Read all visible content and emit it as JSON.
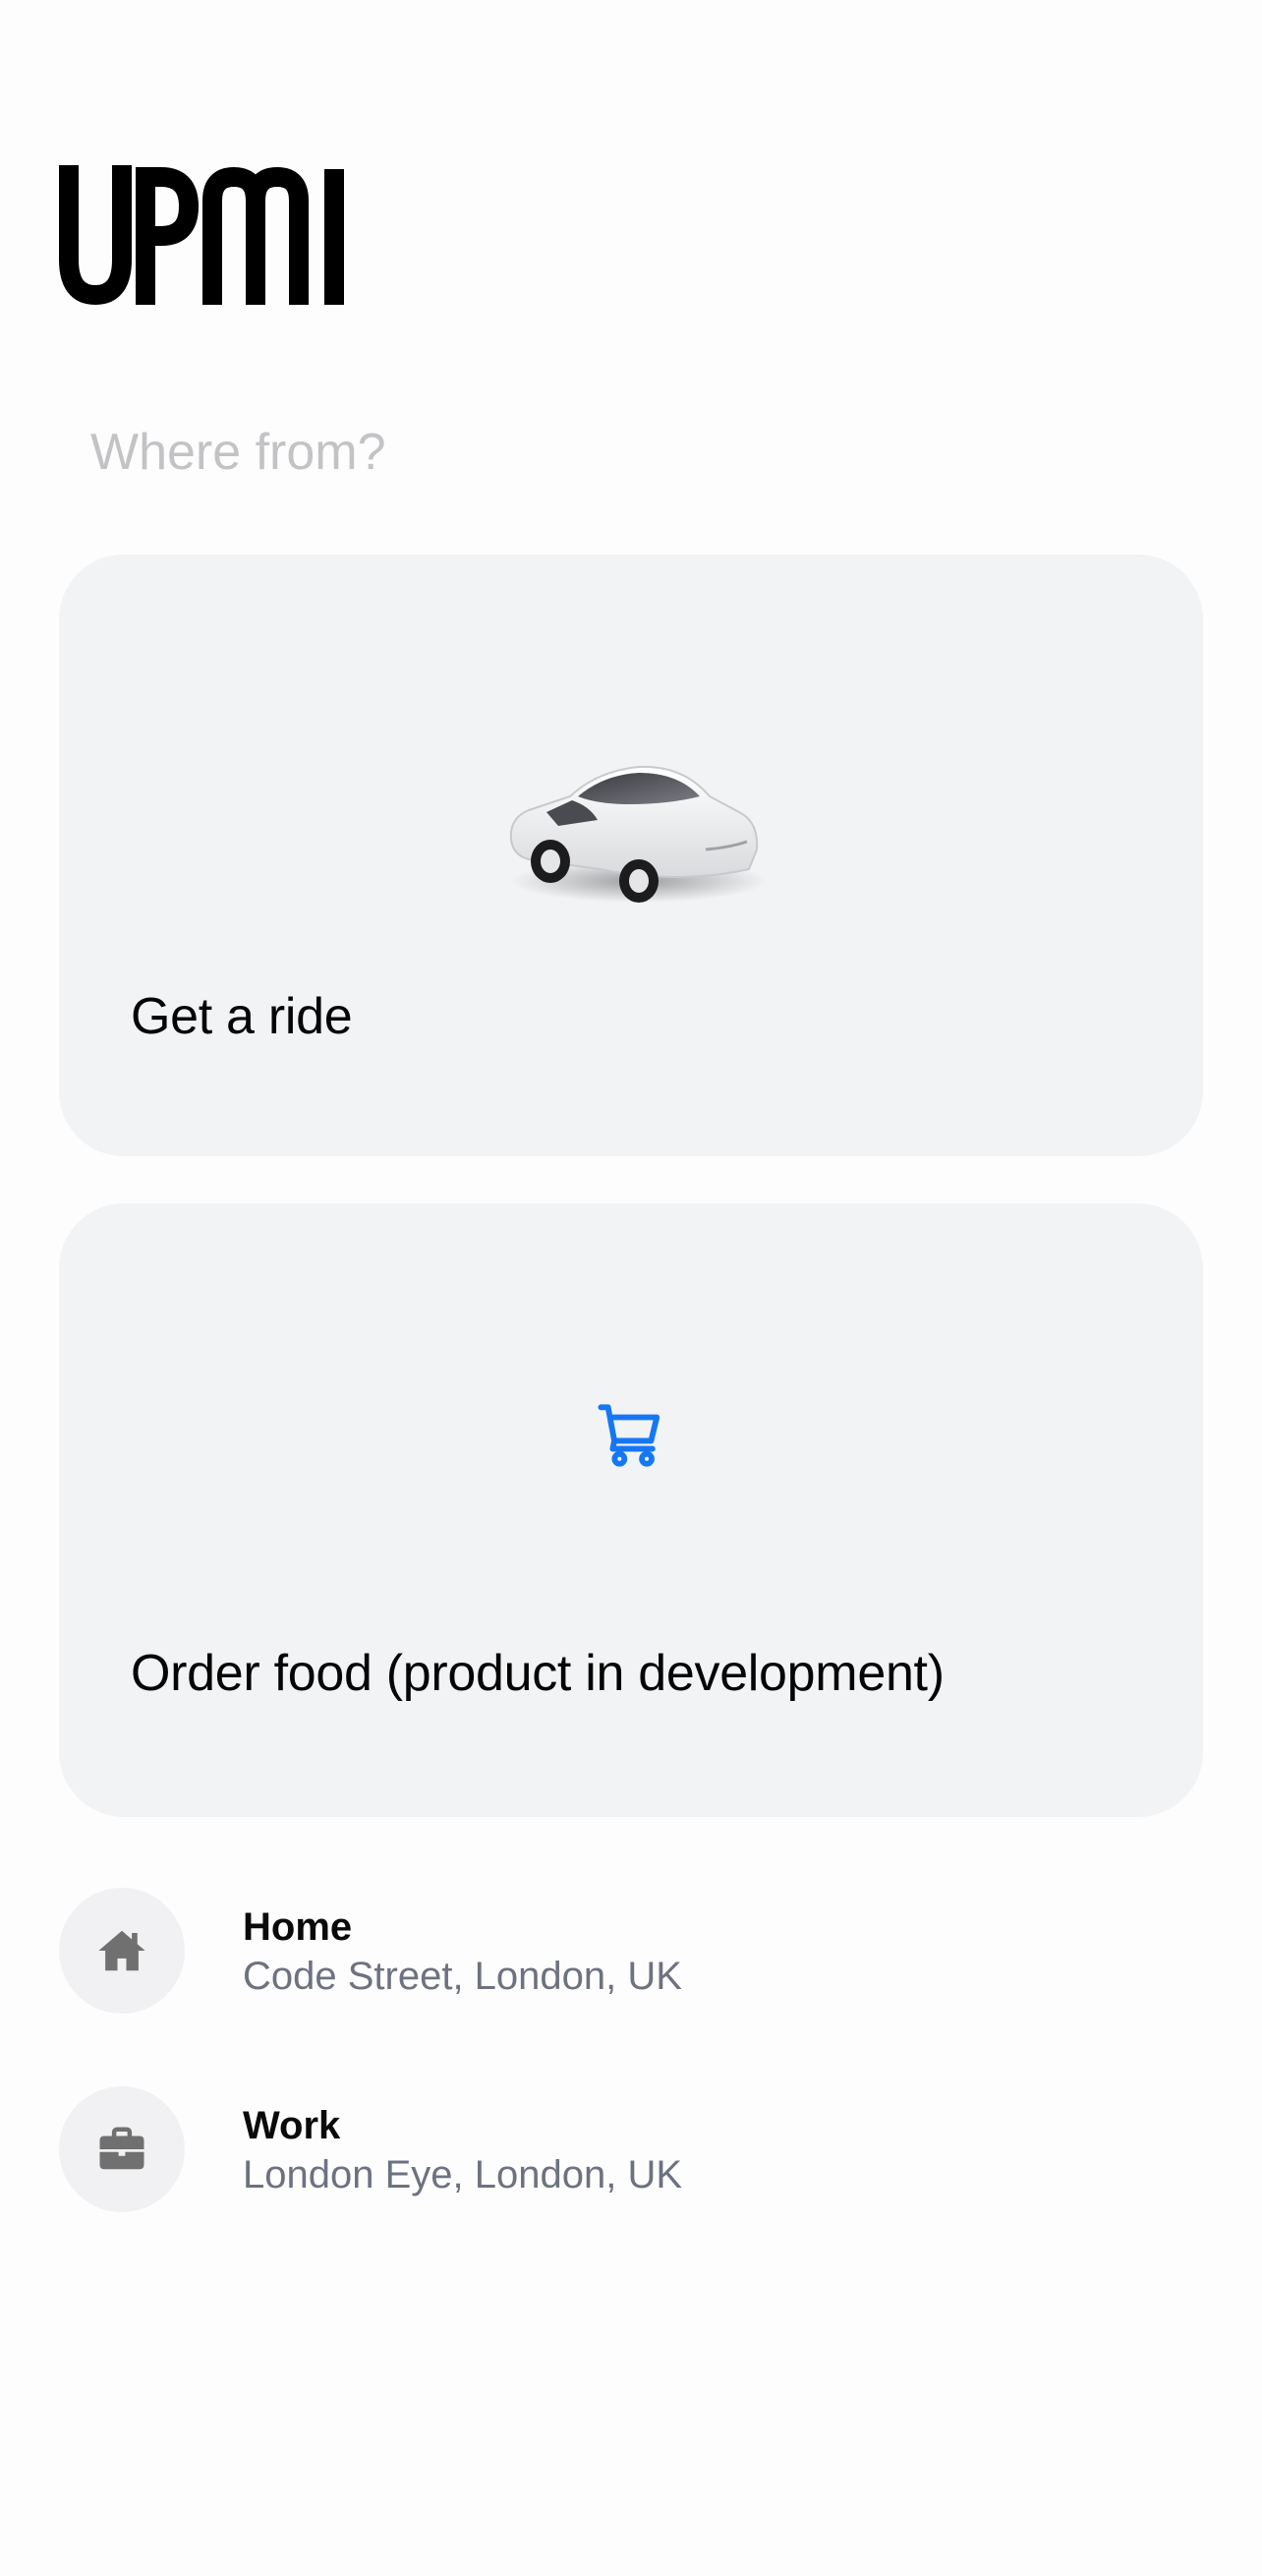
{
  "brand": {
    "logo_text": "UPMI"
  },
  "search": {
    "placeholder": "Where from?",
    "value": ""
  },
  "cards": {
    "ride": {
      "title": "Get a ride",
      "icon": "car-illustration"
    },
    "food": {
      "title": "Order food (product in development)",
      "icon": "cart-icon",
      "icon_color": "#1677f5"
    }
  },
  "places": [
    {
      "name": "Home",
      "address": "Code Street, London, UK",
      "icon": "home-icon"
    },
    {
      "name": "Work",
      "address": "London Eye, London, UK",
      "icon": "briefcase-icon"
    }
  ],
  "colors": {
    "card_background": "#f2f3f5",
    "icon_circle": "#f1f1f3",
    "secondary_text": "#6d7280",
    "placeholder_text": "#c3c3c6"
  }
}
